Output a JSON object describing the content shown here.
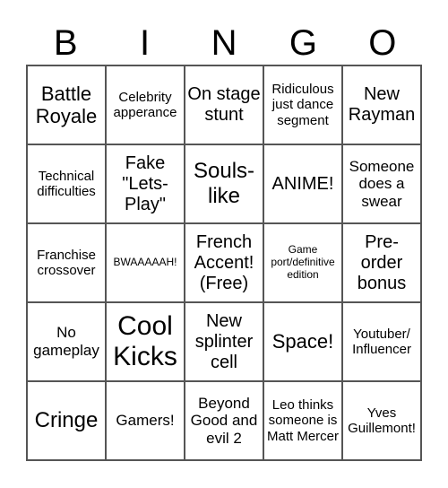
{
  "header": [
    "B",
    "I",
    "N",
    "G",
    "O"
  ],
  "cells": [
    [
      "Battle Royale",
      "Celebrity apperance",
      "On stage stunt",
      "Ridiculous just dance segment",
      "New Rayman"
    ],
    [
      "Technical difficulties",
      "Fake \"Lets-Play\"",
      "Souls-like",
      "ANIME!",
      "Someone does a swear"
    ],
    [
      "Franchise crossover",
      "BWAAAAAH!",
      "French Accent! (Free)",
      "Game port/definitive edition",
      "Pre-order bonus"
    ],
    [
      "No gameplay",
      "Cool Kicks",
      "New splinter cell",
      "Space!",
      "Youtuber/ Influencer"
    ],
    [
      "Cringe",
      "Gamers!",
      "Beyond Good and evil 2",
      "Leo thinks someone is Matt Mercer",
      "Yves Guillemont!"
    ]
  ]
}
